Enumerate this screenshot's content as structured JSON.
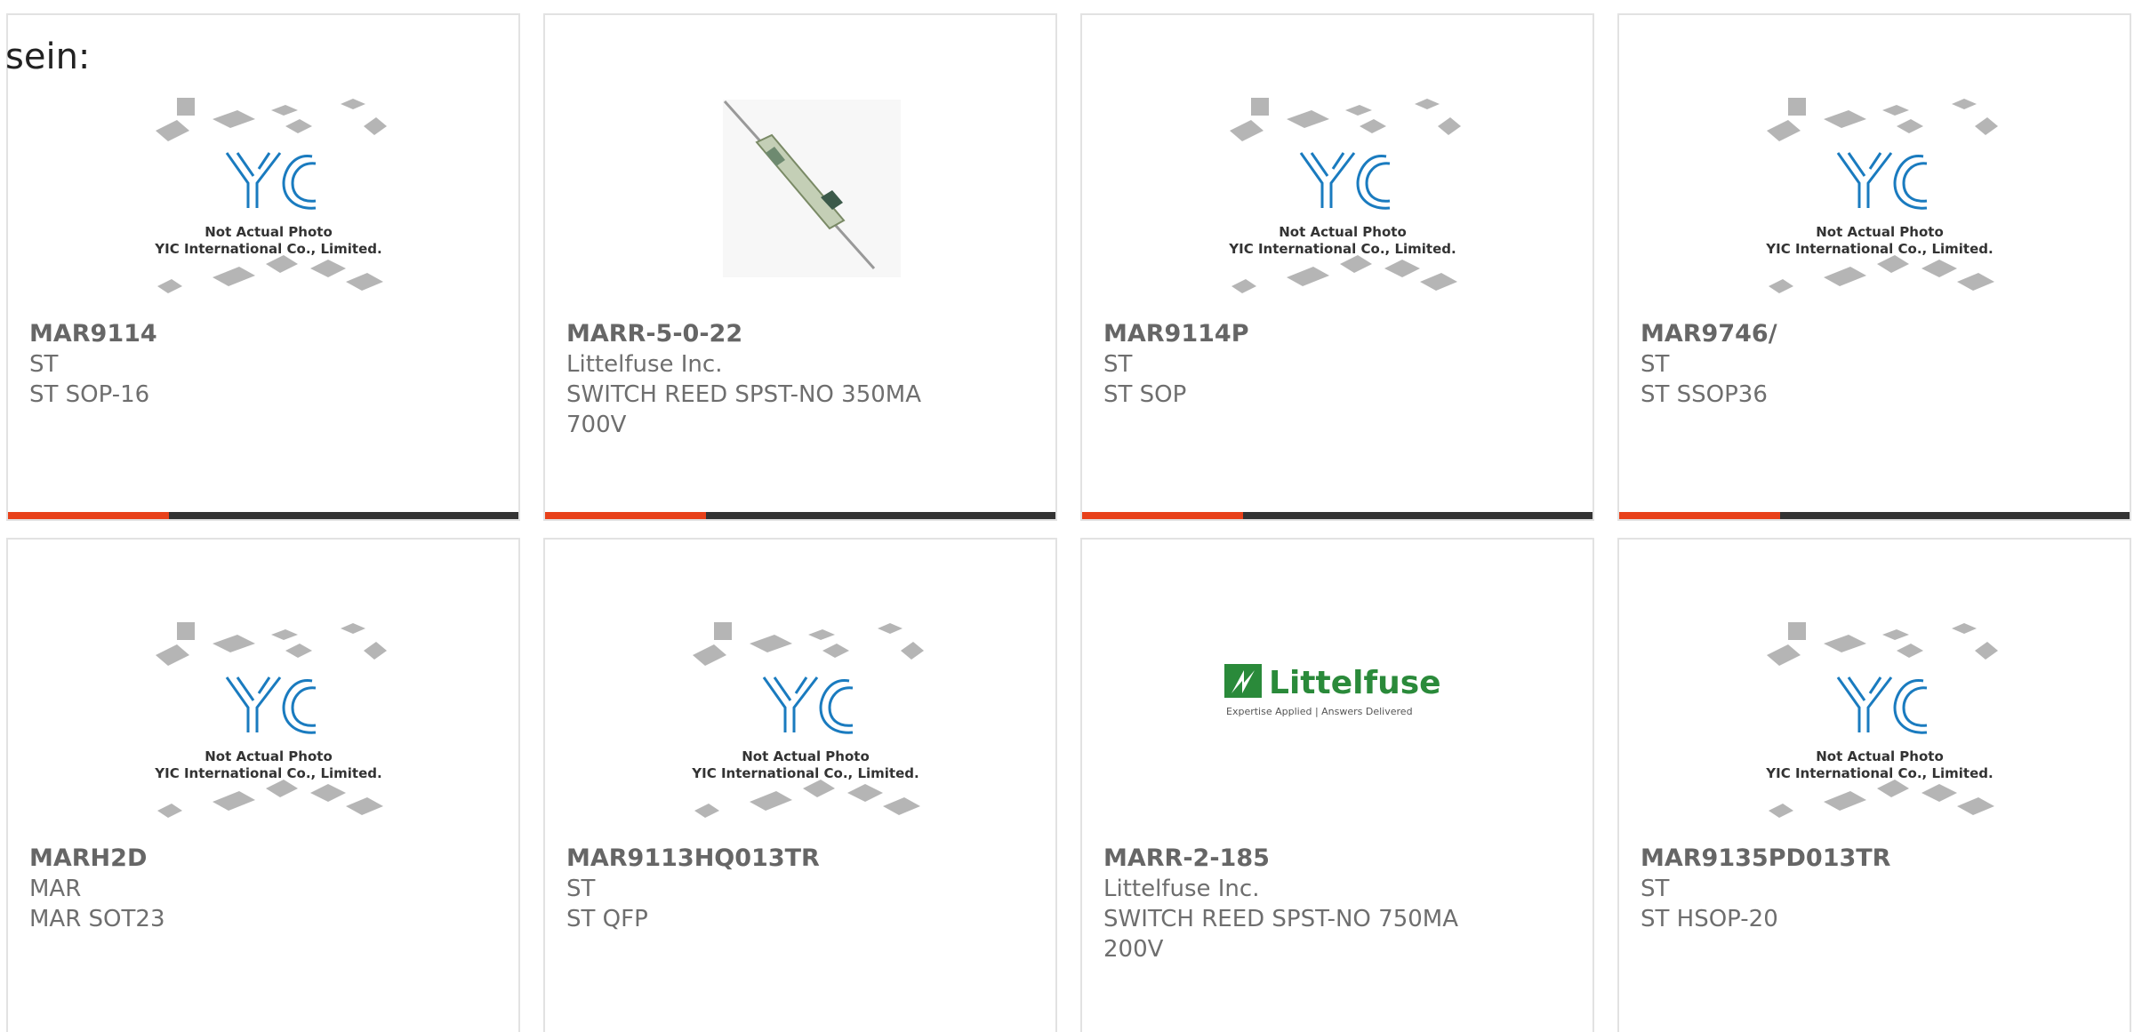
{
  "lead_text": "sein:",
  "colors": {
    "accent": "#e8411a",
    "bar_track": "#333333",
    "card_border": "#e2e2e2",
    "text": "#6e6e6e",
    "yic_blue": "#1a7bbf",
    "littelfuse_green": "#2a8a3a"
  },
  "placeholder_image": {
    "line1": "Not Actual Photo",
    "line2": "YIC International Co., Limited.",
    "logo": "YIC"
  },
  "littelfuse_logo": {
    "name": "Littelfuse",
    "tagline": "Expertise Applied | Answers Delivered"
  },
  "products": [
    {
      "part": "MAR9114",
      "manufacturer": "ST",
      "description": "ST SOP-16",
      "image": "placeholder",
      "progress": 0.315
    },
    {
      "part": "MARR-5-0-22",
      "manufacturer": "Littelfuse Inc.",
      "description": "SWITCH REED SPST-NO 350MA 700V",
      "image": "reed-switch-photo",
      "progress": 0.315
    },
    {
      "part": "MAR9114P",
      "manufacturer": "ST",
      "description": "ST SOP",
      "image": "placeholder",
      "progress": 0.315
    },
    {
      "part": "MAR9746/",
      "manufacturer": "ST",
      "description": "ST SSOP36",
      "image": "placeholder",
      "progress": 0.315
    },
    {
      "part": "MARH2D",
      "manufacturer": "MAR",
      "description": "MAR SOT23",
      "image": "placeholder"
    },
    {
      "part": "MAR9113HQ013TR",
      "manufacturer": "ST",
      "description": "ST QFP",
      "image": "placeholder"
    },
    {
      "part": "MARR-2-185",
      "manufacturer": "Littelfuse Inc.",
      "description": "SWITCH REED SPST-NO 750MA 200V",
      "image": "littelfuse-logo"
    },
    {
      "part": "MAR9135PD013TR",
      "manufacturer": "ST",
      "description": "ST HSOP-20",
      "image": "placeholder"
    }
  ]
}
